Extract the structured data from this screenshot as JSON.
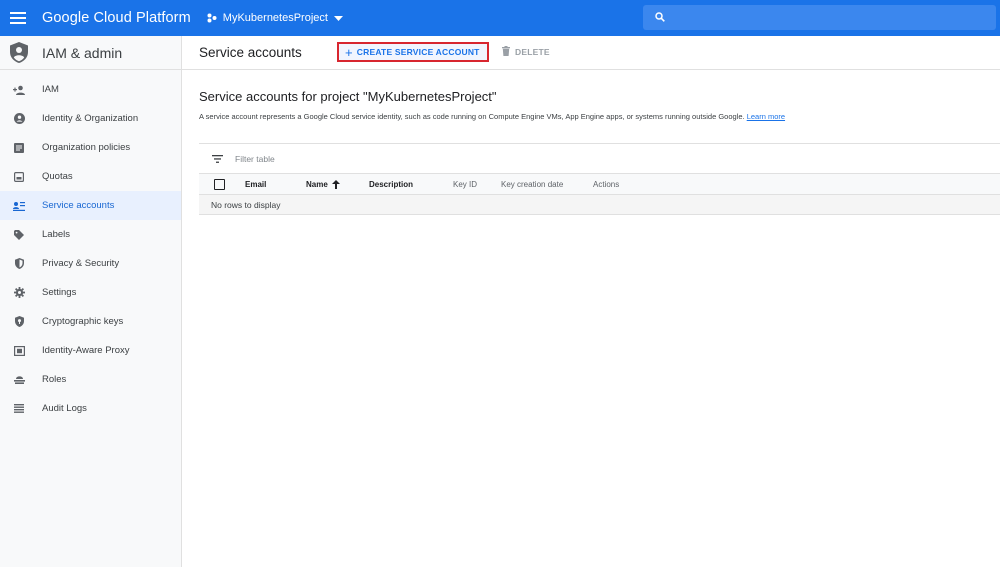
{
  "topbar": {
    "brand": "Google Cloud Platform",
    "project": "MyKubernetesProject",
    "icons": [
      "menu-icon",
      "project-dots-icon",
      "caret-down-icon",
      "search-icon"
    ]
  },
  "sidebar": {
    "title": "IAM & admin",
    "items": [
      {
        "label": "IAM",
        "icon": "person-add-icon"
      },
      {
        "label": "Identity & Organization",
        "icon": "account-circle-icon"
      },
      {
        "label": "Organization policies",
        "icon": "policy-doc-icon"
      },
      {
        "label": "Quotas",
        "icon": "quota-icon"
      },
      {
        "label": "Service accounts",
        "icon": "service-account-icon"
      },
      {
        "label": "Labels",
        "icon": "label-tag-icon"
      },
      {
        "label": "Privacy & Security",
        "icon": "privacy-shield-icon"
      },
      {
        "label": "Settings",
        "icon": "gear-icon"
      },
      {
        "label": "Cryptographic keys",
        "icon": "key-shield-icon"
      },
      {
        "label": "Identity-Aware Proxy",
        "icon": "proxy-icon"
      },
      {
        "label": "Roles",
        "icon": "roles-hat-icon"
      },
      {
        "label": "Audit Logs",
        "icon": "list-icon"
      }
    ],
    "active_index": 4
  },
  "main": {
    "page_title": "Service accounts",
    "create_label": "CREATE SERVICE ACCOUNT",
    "delete_label": "DELETE",
    "section_title": "Service accounts for project \"MyKubernetesProject\"",
    "section_desc": "A service account represents a Google Cloud service identity, such as code running on Compute Engine VMs, App Engine apps, or systems running outside Google.",
    "learn_more": "Learn more",
    "filter_placeholder": "Filter table",
    "columns": {
      "email": "Email",
      "name": "Name",
      "description": "Description",
      "key_id": "Key ID",
      "key_date": "Key creation date",
      "actions": "Actions"
    },
    "empty_message": "No rows to display"
  },
  "colors": {
    "brand_blue": "#1a73e8",
    "highlight_red": "#d8262f",
    "active_bg": "#e8f0fe"
  }
}
